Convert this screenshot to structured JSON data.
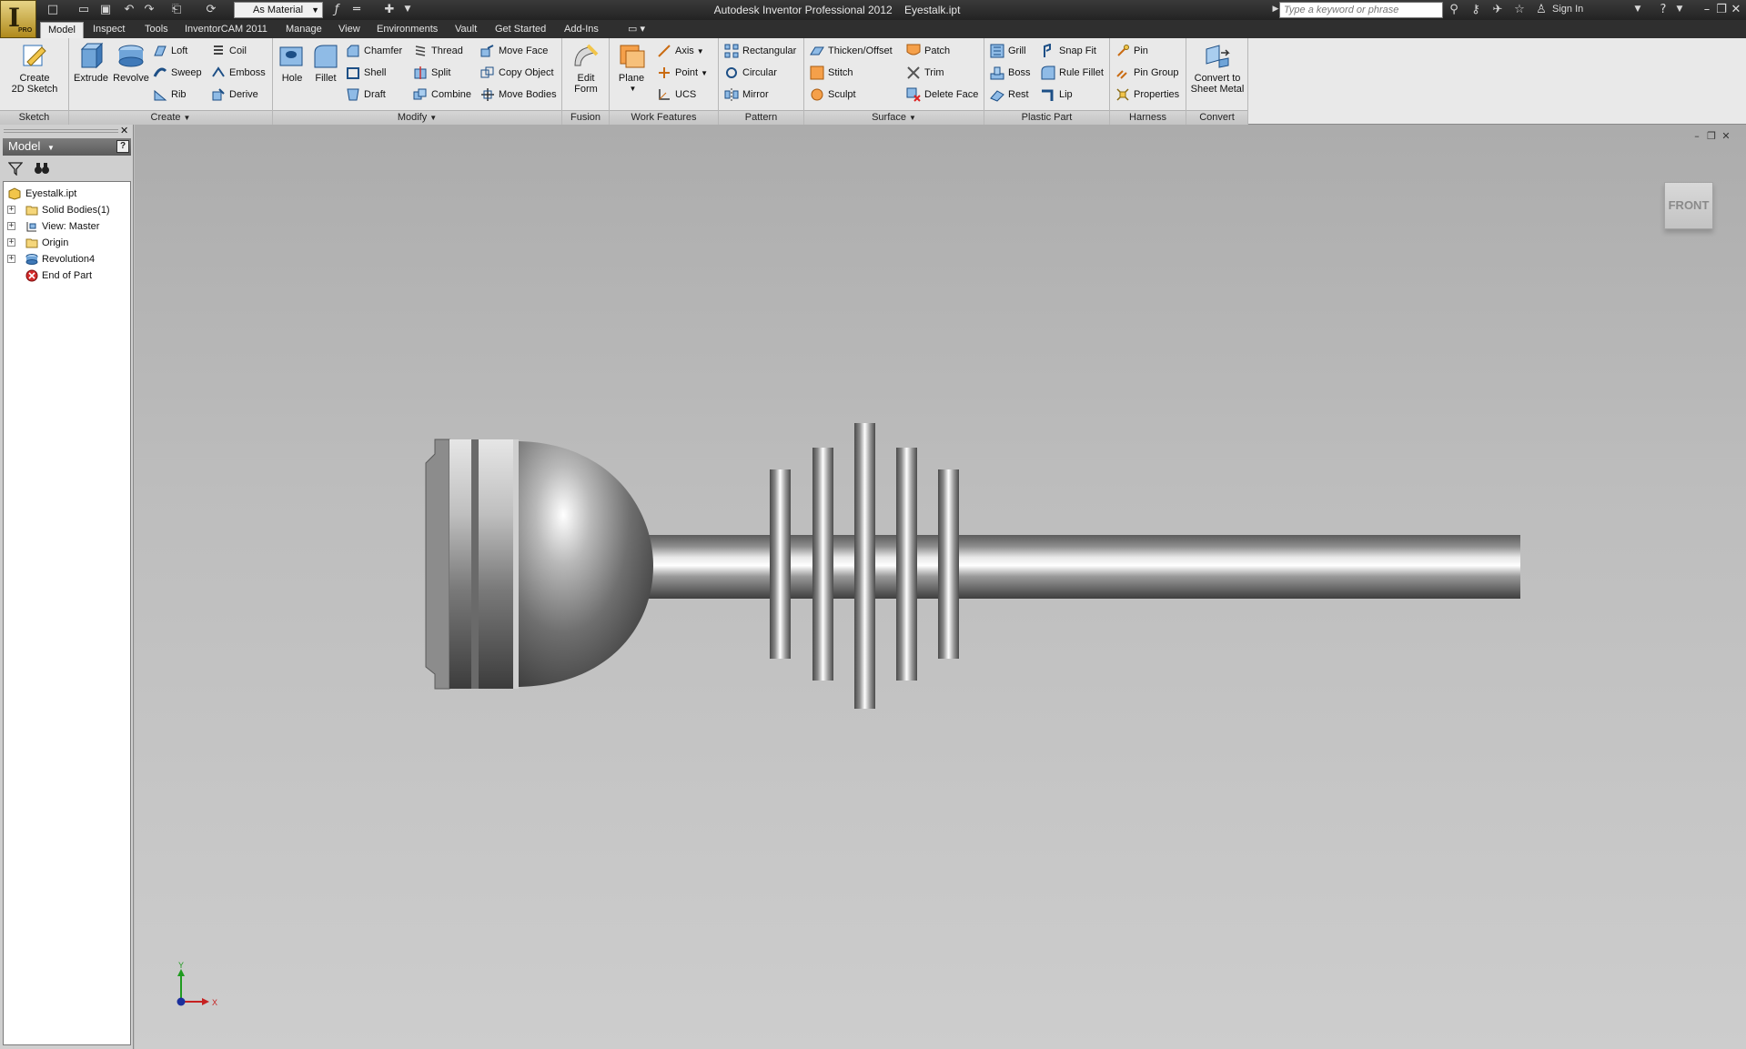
{
  "app": {
    "logo_letter": "I",
    "logo_badge": "PRO",
    "title": "Autodesk Inventor Professional 2012",
    "document": "Eyestalk.ipt"
  },
  "quick_access": {
    "material": "As Material",
    "icons": [
      "new-icon",
      "open-icon",
      "save-icon",
      "undo-icon",
      "redo-icon",
      "return-icon",
      "update-icon",
      "fx-parameters-icon",
      "line-style-icon",
      "measure-icon"
    ]
  },
  "search": {
    "placeholder": "Type a keyword or phrase"
  },
  "user": {
    "sign_in": "Sign In"
  },
  "tabs": [
    "Model",
    "Inspect",
    "Tools",
    "InventorCAM 2011",
    "Manage",
    "View",
    "Environments",
    "Vault",
    "Get Started",
    "Add-Ins"
  ],
  "ribbon": {
    "sketch": {
      "title": "Sketch",
      "create_2d_line1": "Create",
      "create_2d_line2": "2D Sketch"
    },
    "create": {
      "title": "Create",
      "extrude": "Extrude",
      "revolve": "Revolve",
      "loft": "Loft",
      "sweep": "Sweep",
      "rib": "Rib",
      "coil": "Coil",
      "emboss": "Emboss",
      "derive": "Derive"
    },
    "modify": {
      "title": "Modify",
      "hole": "Hole",
      "fillet": "Fillet",
      "chamfer": "Chamfer",
      "shell": "Shell",
      "draft": "Draft",
      "thread": "Thread",
      "split": "Split",
      "combine": "Combine",
      "move_face": "Move Face",
      "copy_object": "Copy Object",
      "move_bodies": "Move Bodies"
    },
    "fusion": {
      "title": "Fusion",
      "edit_form_line1": "Edit",
      "edit_form_line2": "Form"
    },
    "work_features": {
      "title": "Work Features",
      "plane": "Plane",
      "axis": "Axis",
      "point": "Point",
      "ucs": "UCS"
    },
    "pattern": {
      "title": "Pattern",
      "rectangular": "Rectangular",
      "circular": "Circular",
      "mirror": "Mirror"
    },
    "surface": {
      "title": "Surface",
      "thicken_offset": "Thicken/Offset",
      "stitch": "Stitch",
      "sculpt": "Sculpt",
      "patch": "Patch",
      "trim": "Trim",
      "delete_face": "Delete Face"
    },
    "plastic_part": {
      "title": "Plastic Part",
      "grill": "Grill",
      "boss": "Boss",
      "rest": "Rest",
      "snap_fit": "Snap Fit",
      "rule_fillet": "Rule Fillet",
      "lip": "Lip"
    },
    "harness": {
      "title": "Harness",
      "pin": "Pin",
      "pin_group": "Pin Group",
      "properties": "Properties"
    },
    "convert": {
      "title": "Convert",
      "convert_line1": "Convert to",
      "convert_line2": "Sheet Metal"
    }
  },
  "browser": {
    "title": "Model",
    "help": "?",
    "tree": [
      {
        "label": "Eyestalk.ipt"
      },
      {
        "label": "Solid Bodies(1)"
      },
      {
        "label": "View: Master"
      },
      {
        "label": "Origin"
      },
      {
        "label": "Revolution4"
      },
      {
        "label": "End of Part"
      }
    ]
  },
  "viewport": {
    "viewcube_face": "FRONT",
    "triad_y": "Y",
    "triad_x": "X"
  },
  "colors": {
    "title_bar": "#2b2b2b",
    "ribbon_bg": "#e9e9e9",
    "viewport_top": "#acacac",
    "viewport_bottom": "#cdcdcd",
    "logo_gold": "#d4b14a"
  }
}
